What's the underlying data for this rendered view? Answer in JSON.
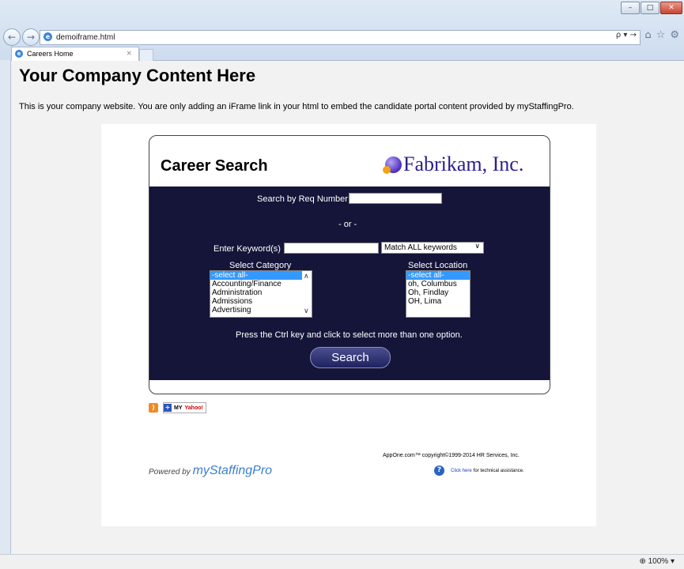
{
  "browser": {
    "url": "demoiframe.html",
    "address_tools": "ρ ▾ →",
    "tab_label": "Careers Home",
    "tab_close": "×",
    "zoom": "100%"
  },
  "page": {
    "title": "Your Company Content Here",
    "description": "This is your company website. You are only adding an iFrame link in your html to embed the candidate portal content provided by myStaffingPro."
  },
  "career": {
    "title": "Career Search",
    "logo_text": "Fabrikam, Inc.",
    "req_label": "Search by Req Number",
    "or_label": "- or -",
    "keyword_label": "Enter Keyword(s)",
    "match_select": "Match ALL keywords",
    "category_label": "Select Category",
    "location_label": "Select Location",
    "categories": [
      "-select all-",
      "Accounting/Finance",
      "Administration",
      "Admissions",
      "Advertising"
    ],
    "locations": [
      "-select all-",
      "oh, Columbus",
      "Oh, Findlay",
      "OH, Lima"
    ],
    "hint": "Press the Ctrl key and click to select more than one option.",
    "search_button": "Search"
  },
  "footer": {
    "my_label": "MY",
    "yahoo_label": "Yahoo!",
    "powered_by": "Powered by",
    "brand": "myStaffingPro",
    "copyright": "AppOne.com™  copyright©1999-2014 HR Services, Inc.",
    "click_here": "Click here",
    "assist_text": "for technical assistance."
  }
}
